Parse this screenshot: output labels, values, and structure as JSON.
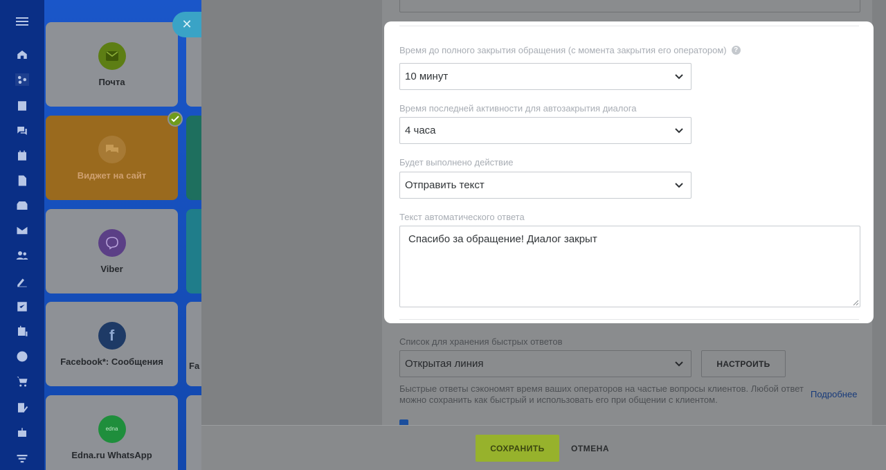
{
  "sidebar": {
    "icons": [
      "menu-icon",
      "home-icon",
      "sites-icon",
      "feed-icon",
      "chat-icon",
      "calendar-icon",
      "document-icon",
      "drive-icon",
      "mail-icon",
      "contacts-icon",
      "sign-icon",
      "tasks-icon",
      "crm-icon",
      "target-icon",
      "shop-icon",
      "edit-icon",
      "robot-icon",
      "filter-icon"
    ]
  },
  "channels": {
    "items": [
      {
        "label": "Почта",
        "icon": "mail-icon"
      },
      {
        "label": "Виджет на сайт",
        "icon": "chat-bubbles-icon",
        "connected": true
      },
      {
        "label": "Viber",
        "icon": "viber-icon"
      },
      {
        "label": "Facebook*: Сообщения",
        "icon": "facebook-icon"
      },
      {
        "label": "Edna.ru WhatsApp",
        "icon": "edna-icon"
      }
    ],
    "partial_next_label": "Fa"
  },
  "form": {
    "close_time": {
      "label": "Время до полного закрытия обращения (с момента закрытия его оператором)",
      "help": "?",
      "value": "10 минут"
    },
    "auto_close_activity": {
      "label": "Время последней активности для автозакрытия диалога",
      "value": "4 часа"
    },
    "action": {
      "label": "Будет выполнено действие",
      "value": "Отправить текст"
    },
    "auto_reply": {
      "label": "Текст автоматического ответа",
      "value": "Спасибо за обращение! Диалог закрыт"
    },
    "quick_answers": {
      "label": "Список для хранения быстрых ответов",
      "value": "Открытая линия",
      "configure_label": "НАСТРОИТЬ",
      "hint": "Быстрые ответы сэкономят время ваших операторов на частые вопросы клиентов. Любой ответ можно сохранить как быстрый и использовать его при общении с клиентом.",
      "more_link": "Подробнее"
    }
  },
  "footer": {
    "save_label": "СОХРАНИТЬ",
    "cancel_label": "ОТМЕНА"
  },
  "colors": {
    "accent_save": "#97b22c",
    "brand_blue": "#1248ad",
    "close_button": "#3aa3c6"
  }
}
